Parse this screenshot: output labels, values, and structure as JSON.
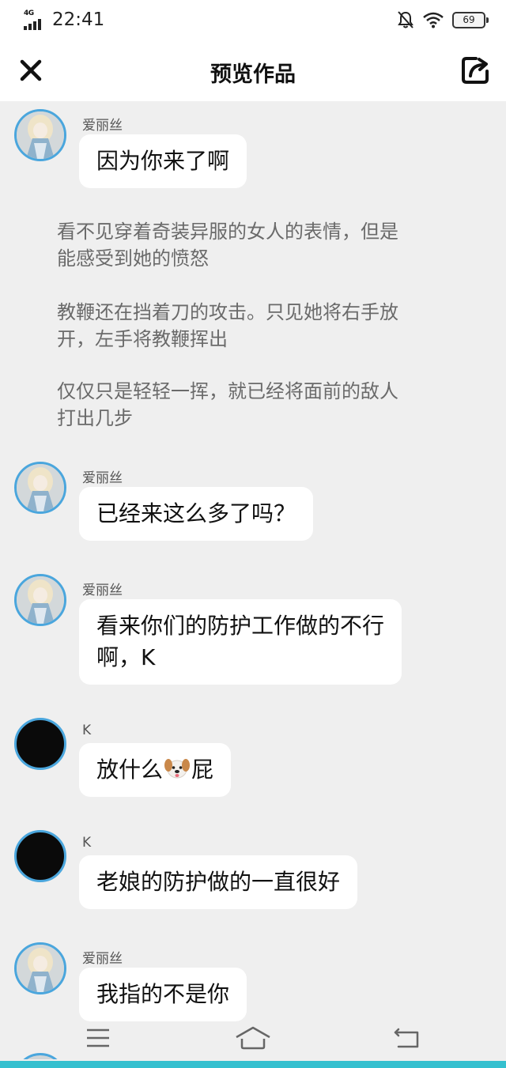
{
  "status_bar": {
    "network": "4G",
    "time": "22:41",
    "battery": "69"
  },
  "header": {
    "title": "预览作品"
  },
  "messages": [
    {
      "sender": "爱丽丝",
      "text": "因为你来了啊"
    },
    {
      "sender": "爱丽丝",
      "text": "已经来这么多了吗？"
    },
    {
      "sender": "爱丽丝",
      "line1": "看来你们的防护工作做的不行",
      "line2": "啊，K"
    },
    {
      "sender": "K",
      "before": "放什么",
      "after": "屁"
    },
    {
      "sender": "K",
      "text": "老娘的防护做的一直很好"
    },
    {
      "sender": "爱丽丝",
      "text": "我指的不是你"
    }
  ],
  "narration": [
    {
      "line1": "看不见穿着奇装异服的女人的表情，但是",
      "line2": "能感受到她的愤怒"
    },
    {
      "line1": "教鞭还在挡着刀的攻击。只见她将右手放",
      "line2": "开，左手将教鞭挥出"
    },
    {
      "line1": "仅仅只是轻轻一挥，就已经将面前的敌人",
      "line2": "打出几步"
    }
  ],
  "icons": {
    "close": "close-icon",
    "share": "share-icon",
    "mute": "bell-off-icon",
    "wifi": "wifi-icon",
    "dog": "dog-emoji",
    "menu": "menu-icon",
    "home": "home-icon",
    "back": "back-icon"
  },
  "colors": {
    "avatar_ring": "#4aa6dd",
    "background": "#efefef",
    "bubble": "#ffffff",
    "accent_bar": "#35c0cf"
  }
}
